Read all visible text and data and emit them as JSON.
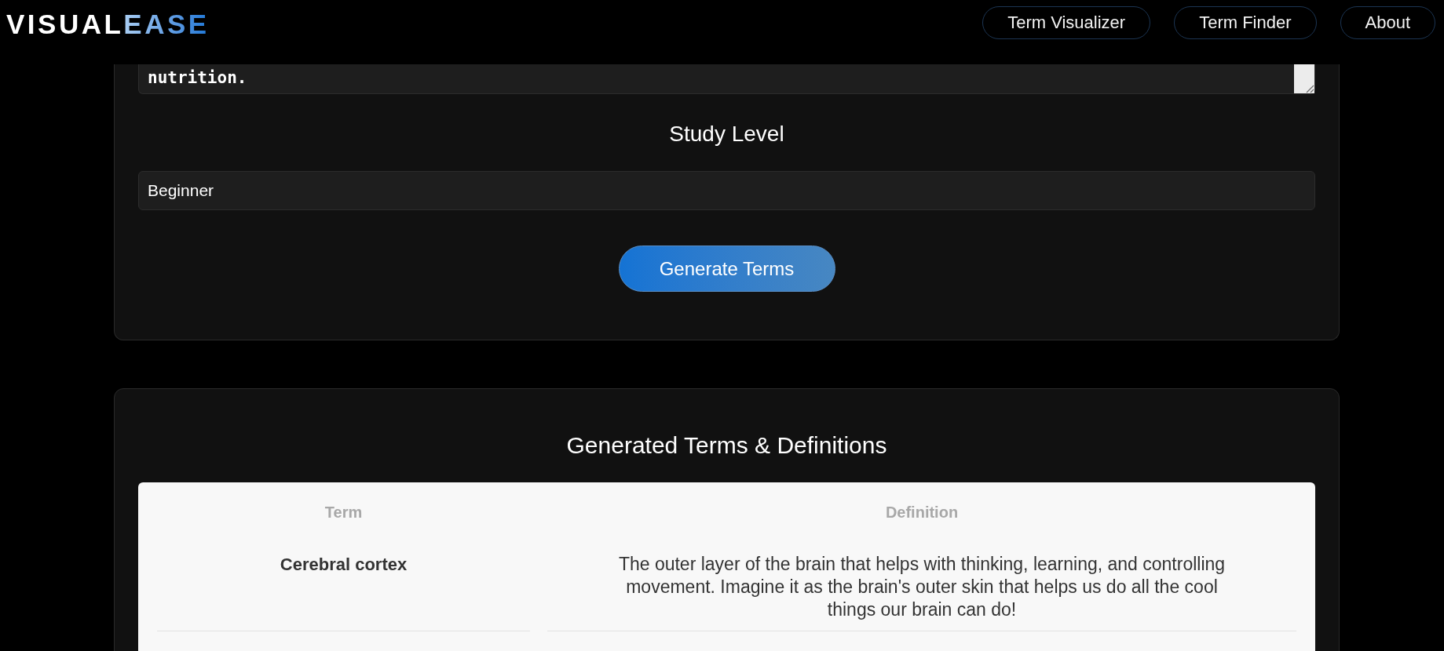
{
  "header": {
    "logo": [
      {
        "text": "VISUAL",
        "kind": "plain"
      },
      {
        "text": "EASE",
        "kind": "gradient"
      }
    ],
    "nav": [
      "Term Visualizer",
      "Term Finder",
      "About"
    ]
  },
  "form_card": {
    "topic_field": {
      "value": "nutrition."
    },
    "study_level": {
      "label": "Study Level",
      "value": "Beginner"
    },
    "generate_button": {
      "label": "Generate Terms"
    }
  },
  "results_card": {
    "title": "Generated Terms & Definitions",
    "table": {
      "columns": [
        "Term",
        "Definition"
      ],
      "rows": [
        {
          "term": "Cerebral cortex",
          "definition": "The outer layer of the brain that helps with thinking, learning, and controlling movement. Imagine it as the brain's outer skin that helps us do all the cool things our brain can do!"
        }
      ]
    }
  }
}
